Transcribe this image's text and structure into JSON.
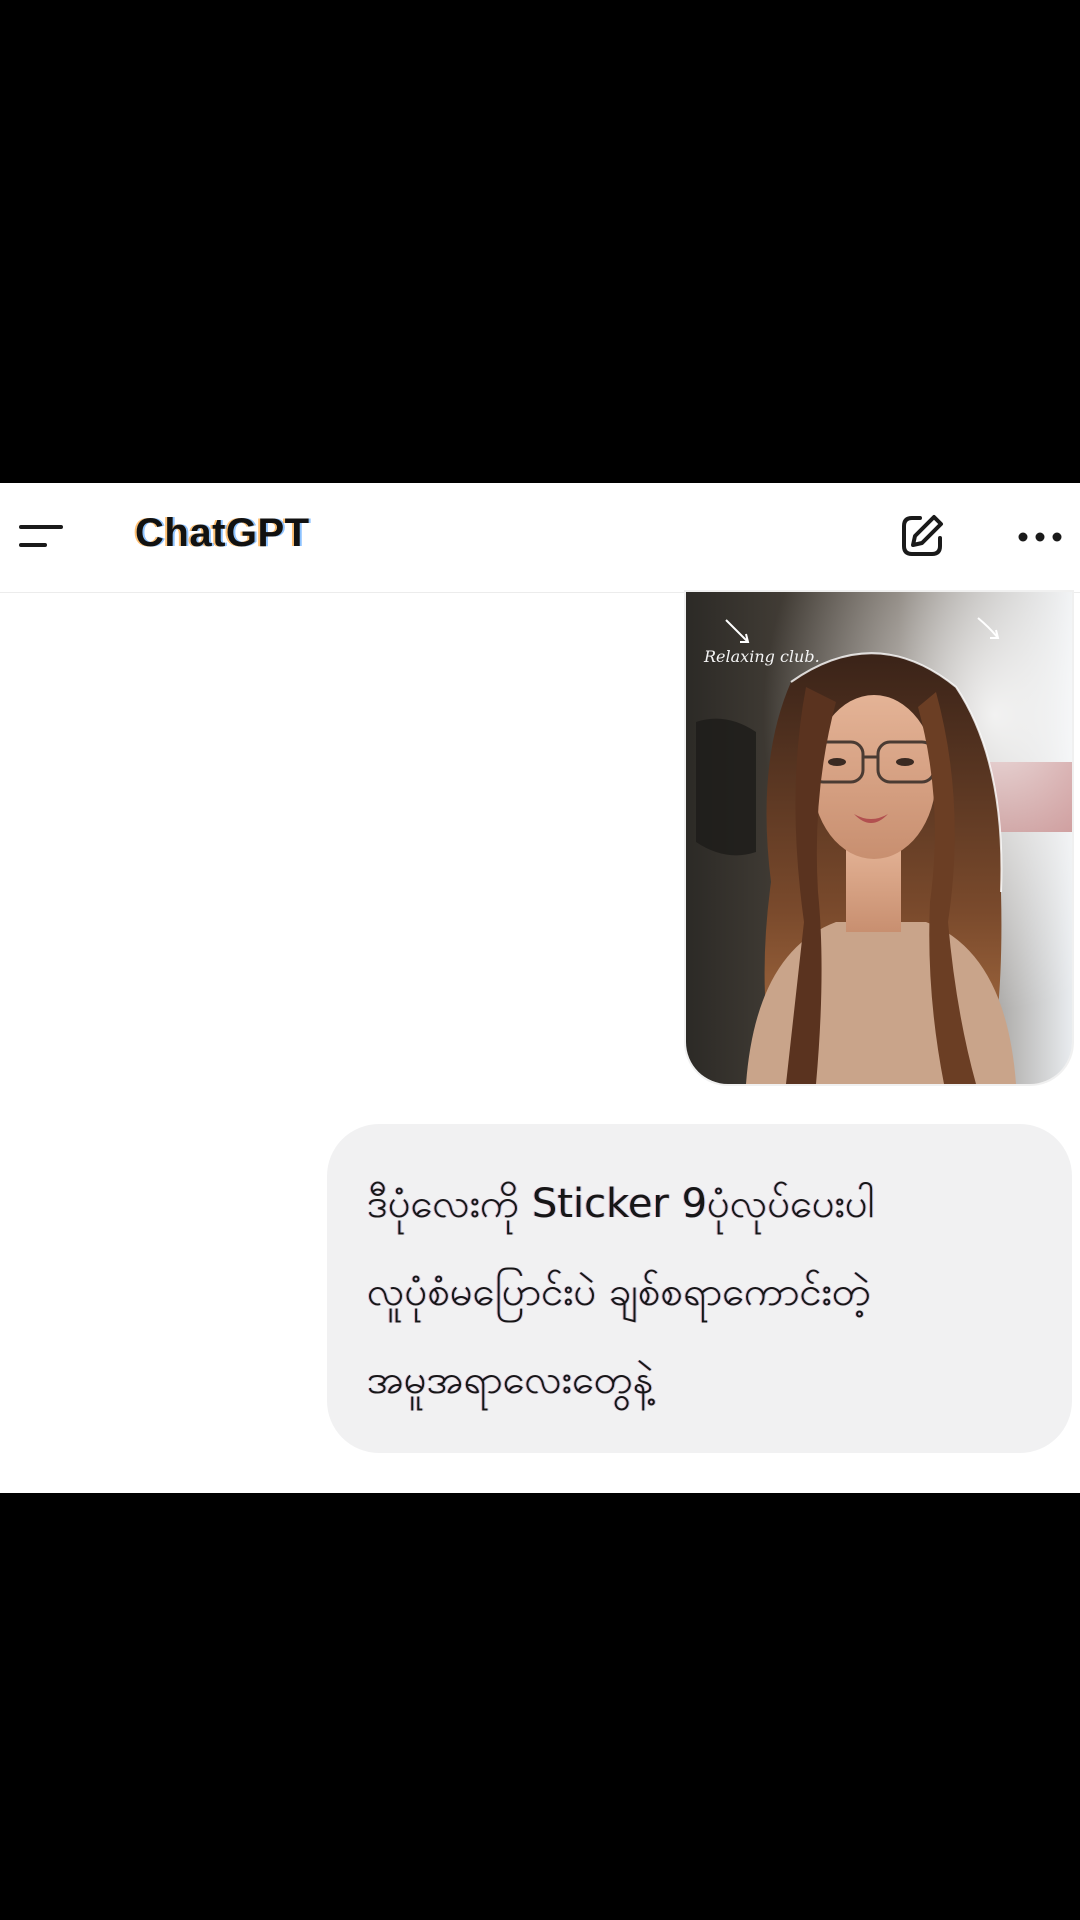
{
  "header": {
    "title": "ChatGPT",
    "icons": {
      "menu": "menu-icon",
      "edit": "new-chat-icon",
      "more": "more-options-icon"
    }
  },
  "message": {
    "image_caption": "Relaxing club.",
    "text_lines": [
      "ဒီပုံလေးကို Sticker 9ပုံလုပ်ပေးပါ",
      "လူပုံစံမပြောင်းပဲ ချစ်စရာကောင်းတဲ့",
      "အမူအရာလေးတွေနဲ့"
    ]
  },
  "colors": {
    "background": "#000000",
    "app_background": "#ffffff",
    "bubble": "#f1f1f2",
    "text": "#161616"
  }
}
